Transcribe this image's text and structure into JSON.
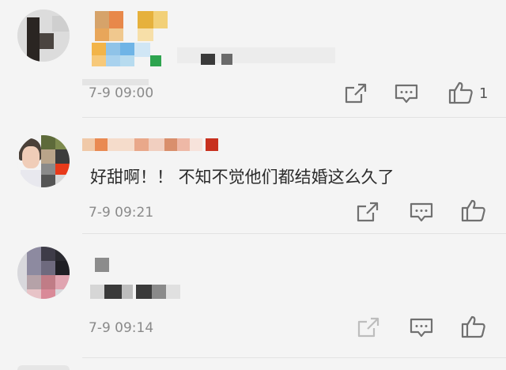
{
  "comments": [
    {
      "time": "7-9 09:00",
      "like_count": "1",
      "icons": [
        "share-icon",
        "reply-icon",
        "like-icon"
      ]
    },
    {
      "text": "好甜啊！！ 不知不觉他们都结婚这么久了",
      "time": "7-9 09:21",
      "icons": [
        "share-icon",
        "reply-icon",
        "like-icon"
      ]
    },
    {
      "time": "7-9 09:14",
      "icons": [
        "share-icon",
        "reply-icon",
        "like-icon"
      ]
    }
  ]
}
